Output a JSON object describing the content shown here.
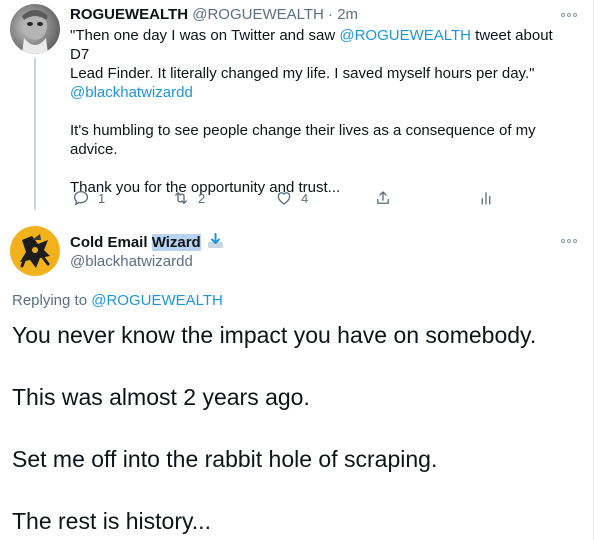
{
  "parent_tweet": {
    "display_name": "ROGUEWEALTH",
    "handle": "@ROGUEWEALTH",
    "separator": "·",
    "time": "2m",
    "text": {
      "line1_a": "\"Then one day I was on Twitter and saw ",
      "mention": "@ROGUEWEALTH",
      "line1_b": " tweet about D7",
      "line2": "Lead Finder. It literally changed my life. I saved myself hours per day.\"",
      "handle_link": "@blackhatwizardd",
      "para2_line1": "It's humbling to see people change their lives as a consequence of my",
      "para2_line2": "advice.",
      "para3": "Thank you for the opportunity and trust..."
    },
    "actions": {
      "reply_count": "1",
      "retweet_count": "2",
      "like_count": "4",
      "share_icon": "share-icon",
      "analytics_icon": "analytics-icon"
    }
  },
  "reply_tweet": {
    "display_name_a": "Cold Email ",
    "display_name_b": "Wizard",
    "handle": "@blackhatwizardd",
    "replying_to_label": "Replying to ",
    "replying_to_handle": "@ROGUEWEALTH",
    "lines": [
      "You never know the impact you have on somebody.",
      "This was almost 2 years ago.",
      "Set me off into the rabbit hole of scraping.",
      "The rest is history..."
    ]
  },
  "colors": {
    "link": "#1b95e0",
    "muted": "#5b7083",
    "text": "#0f1419",
    "avatar_bg": "#f2b21e"
  }
}
